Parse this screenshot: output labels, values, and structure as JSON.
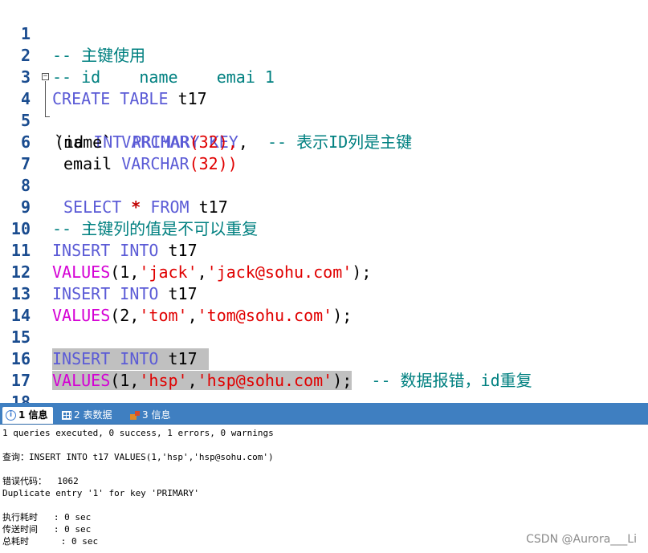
{
  "editor": {
    "line_numbers": [
      "1",
      "2",
      "3",
      "4",
      "5",
      "6",
      "7",
      "8",
      "9",
      "10",
      "11",
      "12",
      "13",
      "14",
      "15",
      "16",
      "17",
      "18"
    ],
    "lines": {
      "l1": {
        "comment": "-- 主键使用"
      },
      "l2": {
        "comment": "-- id    name    emai 1"
      },
      "l3": {
        "kw1": "CREATE",
        "kw2": "TABLE",
        "ident": "t17"
      },
      "l4": {
        "paren": "(",
        "col": "id",
        "type": "INT",
        "kw1": "PRIMARY",
        "kw2": "KEY",
        "comma": ",",
        "comment": "-- 表示ID列是主键"
      },
      "l5": {
        "col": "`name`",
        "type": "VARCHAR",
        "args": "(32),"
      },
      "l6": {
        "col": "email",
        "type": "VARCHAR",
        "args": "(32))"
      },
      "l8": {
        "kw1": "SELECT",
        "star": "*",
        "kw2": "FROM",
        "ident": "t17"
      },
      "l9": {
        "comment": "-- 主键列的值是不可以重复"
      },
      "l10": {
        "kw1": "INSERT",
        "kw2": "INTO",
        "ident": "t17"
      },
      "l11": {
        "fn": "VALUES",
        "p1": "(1,",
        "s1": "'jack'",
        "c1": ",",
        "s2": "'jack@sohu.com'",
        "end": ");"
      },
      "l12": {
        "kw1": "INSERT",
        "kw2": "INTO",
        "ident": "t17"
      },
      "l13": {
        "fn": "VALUES",
        "p1": "(2,",
        "s1": "'tom'",
        "c1": ",",
        "s2": "'tom@sohu.com'",
        "end": ");"
      },
      "l15": {
        "kw1": "INSERT",
        "kw2": "INTO",
        "ident": "t17"
      },
      "l16": {
        "fn": "VALUES",
        "p1": "(1,",
        "s1": "'hsp'",
        "c1": ",",
        "s2": "'hsp@sohu.com'",
        "end": ");",
        "comment": "-- 数据报错，id重复"
      }
    }
  },
  "tabs": [
    {
      "num": "1",
      "label": "信息"
    },
    {
      "num": "2",
      "label": "表数据"
    },
    {
      "num": "3",
      "label": "信息"
    }
  ],
  "output": {
    "summary": "1 queries executed, 0 success, 1 errors, 0 warnings",
    "query": "查询：INSERT INTO t17 VALUES(1,'hsp','hsp@sohu.com')",
    "error_code": "错误代码：  1062",
    "error_msg": "Duplicate entry '1' for key 'PRIMARY'",
    "exec_time": "执行耗时   : 0 sec",
    "transfer_time": "传送时间   : 0 sec",
    "total_time": "总耗时      : 0 sec"
  },
  "watermark": "CSDN @Aurora___Li",
  "colors": {
    "keyword": "#5b5bd6",
    "string": "#e00000",
    "function": "#d400d4",
    "comment": "#008080",
    "tabbar": "#3f7fc1"
  }
}
